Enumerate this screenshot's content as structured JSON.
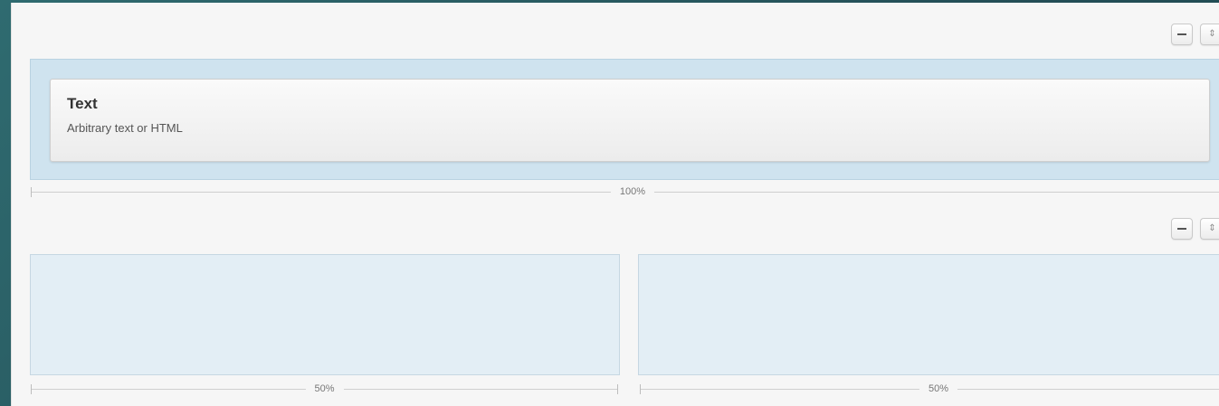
{
  "rows": [
    {
      "width_label": "100%",
      "widgets": [
        {
          "title": "Text",
          "description": "Arbitrary text or HTML"
        }
      ]
    },
    {
      "columns": [
        {
          "width_label": "50%"
        },
        {
          "width_label": "50%"
        }
      ]
    }
  ],
  "icons": {
    "remove": "minus-icon",
    "sort": "updown-arrows-icon"
  }
}
